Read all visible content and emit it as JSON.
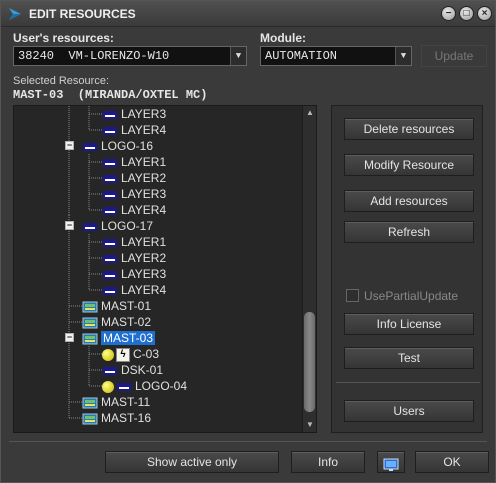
{
  "window": {
    "title": "EDIT RESOURCES"
  },
  "resources": {
    "label": "User's resources:",
    "value": "38240  VM-LORENZO-W10"
  },
  "module": {
    "label": "Module:",
    "value": "AUTOMATION"
  },
  "update_label": "Update",
  "selected": {
    "label": "Selected Resource:",
    "value": "MAST-03  (MIRANDA/OXTEL MC)"
  },
  "tree": {
    "rows": [
      {
        "label": "LAYER3"
      },
      {
        "label": "LAYER4"
      },
      {
        "label": "LOGO-16"
      },
      {
        "label": "LAYER1"
      },
      {
        "label": "LAYER2"
      },
      {
        "label": "LAYER3"
      },
      {
        "label": "LAYER4"
      },
      {
        "label": "LOGO-17"
      },
      {
        "label": "LAYER1"
      },
      {
        "label": "LAYER2"
      },
      {
        "label": "LAYER3"
      },
      {
        "label": "LAYER4"
      },
      {
        "label": "MAST-01"
      },
      {
        "label": "MAST-02"
      },
      {
        "label": "MAST-03"
      },
      {
        "label": "C-03"
      },
      {
        "label": "DSK-01"
      },
      {
        "label": "LOGO-04"
      },
      {
        "label": "MAST-11"
      },
      {
        "label": "MAST-16"
      }
    ]
  },
  "actions": {
    "delete": "Delete resources",
    "modify": "Modify Resource",
    "add": "Add resources",
    "refresh": "Refresh",
    "partial": "UsePartialUpdate",
    "info_license": "Info License",
    "test": "Test",
    "users": "Users"
  },
  "footer": {
    "show_active": "Show active only",
    "info": "Info",
    "ok": "OK"
  }
}
